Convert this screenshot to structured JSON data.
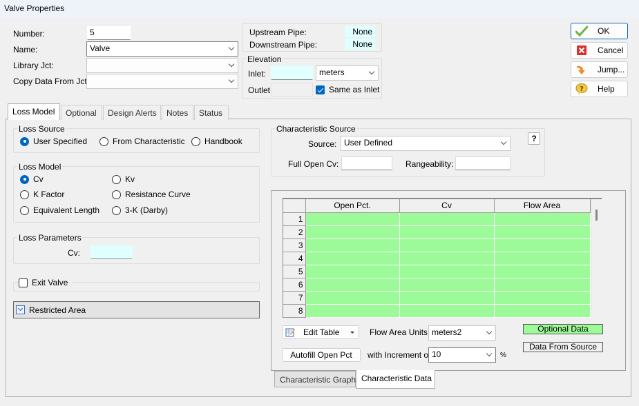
{
  "window": {
    "title": "Valve Properties"
  },
  "header": {
    "number_label": "Number:",
    "number_value": "5",
    "name_label": "Name:",
    "name_value": "Valve",
    "library_label": "Library Jct:",
    "library_value": "",
    "copy_label": "Copy Data From Jct...",
    "copy_value": ""
  },
  "pipes": {
    "upstream_label": "Upstream Pipe:",
    "upstream_value": "None",
    "downstream_label": "Downstream Pipe:",
    "downstream_value": "None"
  },
  "elevation": {
    "title": "Elevation",
    "inlet_label": "Inlet:",
    "inlet_value": "",
    "units": "meters",
    "outlet_label": "Outlet:",
    "outlet_value": "",
    "same_as_inlet_label": "Same as Inlet",
    "same_as_inlet_checked": true
  },
  "buttons": {
    "ok": "OK",
    "cancel": "Cancel",
    "jump": "Jump...",
    "help": "Help"
  },
  "tabs": [
    {
      "label": "Loss Model",
      "active": true
    },
    {
      "label": "Optional",
      "active": false
    },
    {
      "label": "Design Alerts",
      "active": false
    },
    {
      "label": "Notes",
      "active": false
    },
    {
      "label": "Status",
      "active": false
    }
  ],
  "loss_source": {
    "title": "Loss Source",
    "options": [
      "User Specified",
      "From Characteristic",
      "Handbook"
    ],
    "selected": "User Specified"
  },
  "loss_model": {
    "title": "Loss Model",
    "options": [
      "Cv",
      "Kv",
      "K Factor",
      "Resistance Curve",
      "Equivalent Length",
      "3-K (Darby)"
    ],
    "selected": "Cv"
  },
  "loss_parameters": {
    "title": "Loss Parameters",
    "cv_label": "Cv:",
    "cv_value": ""
  },
  "exit_valve": {
    "label": "Exit Valve",
    "checked": false
  },
  "restricted_area": {
    "label": "Restricted Area"
  },
  "characteristic_source": {
    "title": "Characteristic Source",
    "source_label": "Source:",
    "source_value": "User Defined",
    "full_open_cv_label": "Full Open Cv:",
    "full_open_cv_value": "",
    "rangeability_label": "Rangeability:",
    "rangeability_value": "",
    "help_label": "?"
  },
  "table": {
    "columns": [
      "Open Pct.",
      "Cv",
      "Flow Area"
    ],
    "rows": [
      {
        "num": "1",
        "cells": [
          "",
          "",
          ""
        ]
      },
      {
        "num": "2",
        "cells": [
          "",
          "",
          ""
        ]
      },
      {
        "num": "3",
        "cells": [
          "",
          "",
          ""
        ]
      },
      {
        "num": "4",
        "cells": [
          "",
          "",
          ""
        ]
      },
      {
        "num": "5",
        "cells": [
          "",
          "",
          ""
        ]
      },
      {
        "num": "6",
        "cells": [
          "",
          "",
          ""
        ]
      },
      {
        "num": "7",
        "cells": [
          "",
          "",
          ""
        ]
      },
      {
        "num": "8",
        "cells": [
          "",
          "",
          ""
        ]
      }
    ]
  },
  "table_controls": {
    "edit_table": "Edit Table",
    "flow_area_units_label": "Flow Area Units:",
    "flow_area_units_value": "meters2",
    "autofill": "Autofill Open Pct",
    "increment_label": "with Increment of",
    "increment_value": "10",
    "increment_unit": "%",
    "legend_optional": "Optional Data",
    "legend_source": "Data From Source"
  },
  "subtabs": [
    {
      "label": "Characteristic Graph",
      "active": false
    },
    {
      "label": "Characteristic Data",
      "active": true
    }
  ],
  "colors": {
    "accent": "#0067c0",
    "optional_data": "#9cfa98",
    "cyan_field": "#e0ffff"
  }
}
